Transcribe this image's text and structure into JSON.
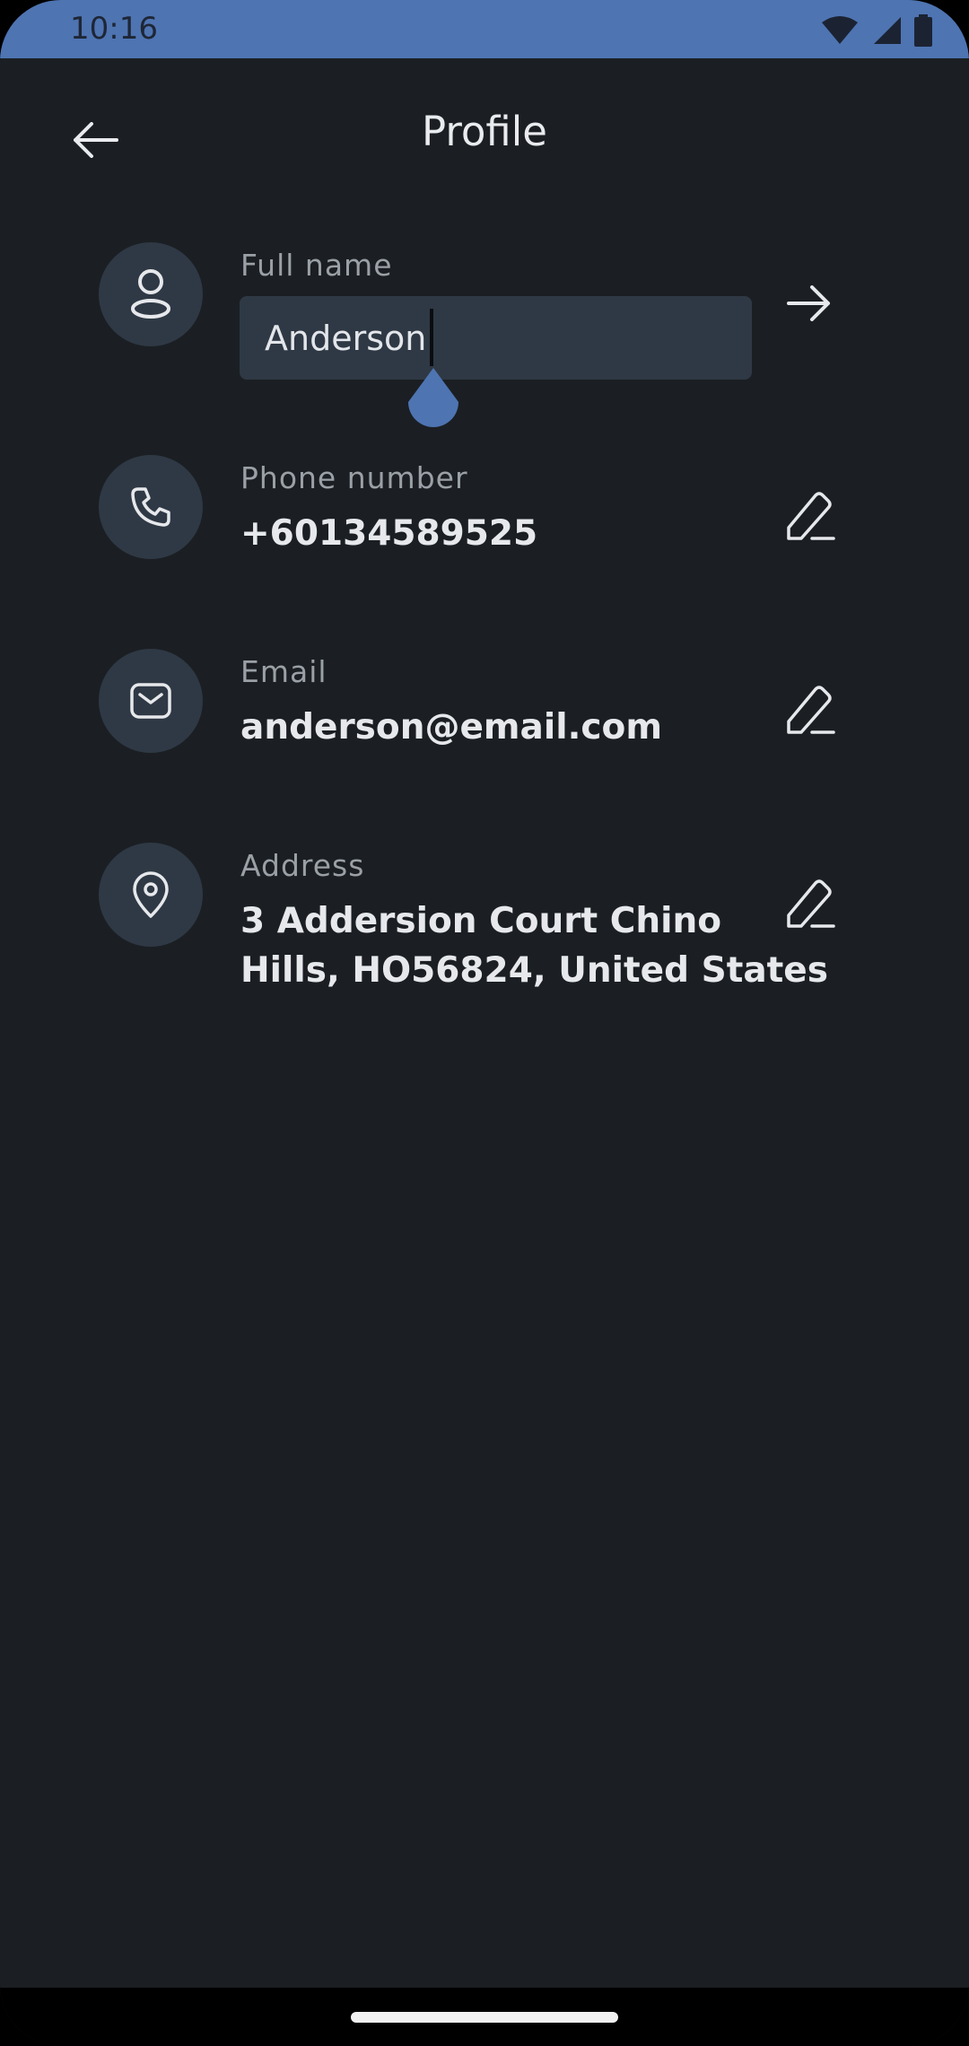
{
  "status_bar": {
    "time": "10:16"
  },
  "header": {
    "title": "Profile"
  },
  "fields": {
    "full_name": {
      "label": "Full name",
      "value": "Anderson"
    },
    "phone": {
      "label": "Phone number",
      "value": "+60134589525"
    },
    "email": {
      "label": "Email",
      "value": "anderson@email.com"
    },
    "address": {
      "label": "Address",
      "line1": "3 Addersion Court Chino",
      "line2": "Hills, HO56824, United States"
    }
  },
  "icons": {
    "back": "arrow-left-icon",
    "user": "user-icon",
    "phone": "phone-icon",
    "email": "mail-icon",
    "address": "map-pin-icon",
    "submit": "arrow-right-icon",
    "edit": "pencil-icon"
  },
  "colors": {
    "background": "#1b1f23",
    "status_bar": "#4e74b2",
    "circle": "#2f3945",
    "text": "#e6e8eb",
    "label": "#9aa0a6"
  }
}
